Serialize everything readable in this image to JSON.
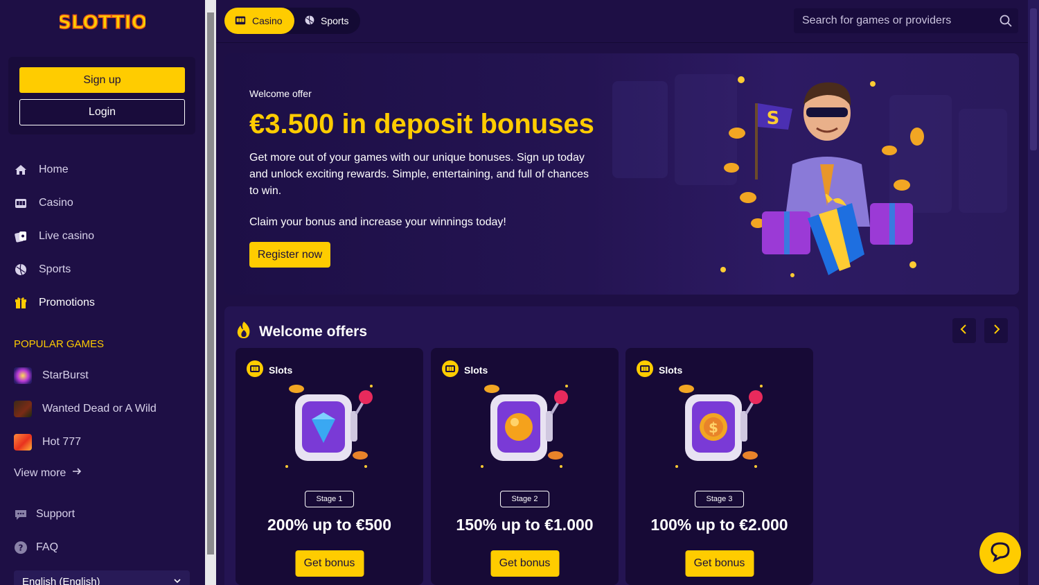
{
  "brand": {
    "name": "SLOTTIO",
    "accent": "#ffcc00",
    "background": "#1e0f45"
  },
  "auth": {
    "signup": "Sign up",
    "login": "Login"
  },
  "nav": [
    {
      "label": "Home",
      "icon": "home-icon"
    },
    {
      "label": "Casino",
      "icon": "slot-machine-icon"
    },
    {
      "label": "Live casino",
      "icon": "cards-icon"
    },
    {
      "label": "Sports",
      "icon": "ball-icon"
    },
    {
      "label": "Promotions",
      "icon": "gift-icon"
    }
  ],
  "popular": {
    "title": "POPULAR GAMES",
    "games": [
      "StarBurst",
      "Wanted Dead or A Wild",
      "Hot 777"
    ],
    "view_more": "View more"
  },
  "footer_nav": [
    {
      "label": "Support",
      "icon": "chat-bubble-icon"
    },
    {
      "label": "FAQ",
      "icon": "question-icon"
    }
  ],
  "language": "English (English)",
  "topbar": {
    "tabs": [
      {
        "label": "Casino"
      },
      {
        "label": "Sports"
      }
    ],
    "search_placeholder": "Search for games or providers"
  },
  "hero": {
    "subtitle": "Welcome offer",
    "title": "€3.500 in deposit bonuses",
    "description": "Get more out of your games with our unique bonuses. Sign up today and unlock exciting rewards. Simple, entertaining, and full of chances to win.",
    "claim": "Claim your bonus and increase your winnings today!",
    "button": "Register now"
  },
  "offers": {
    "title": "Welcome offers",
    "cards": [
      {
        "tag": "Slots",
        "stage": "Stage 1",
        "amount": "200% up to €500",
        "button": "Get bonus",
        "symbol": "diamond"
      },
      {
        "tag": "Slots",
        "stage": "Stage 2",
        "amount": "150% up to €1.000",
        "button": "Get bonus",
        "symbol": "orange"
      },
      {
        "tag": "Slots",
        "stage": "Stage 3",
        "amount": "100% up to €2.000",
        "button": "Get bonus",
        "symbol": "coin"
      }
    ]
  }
}
